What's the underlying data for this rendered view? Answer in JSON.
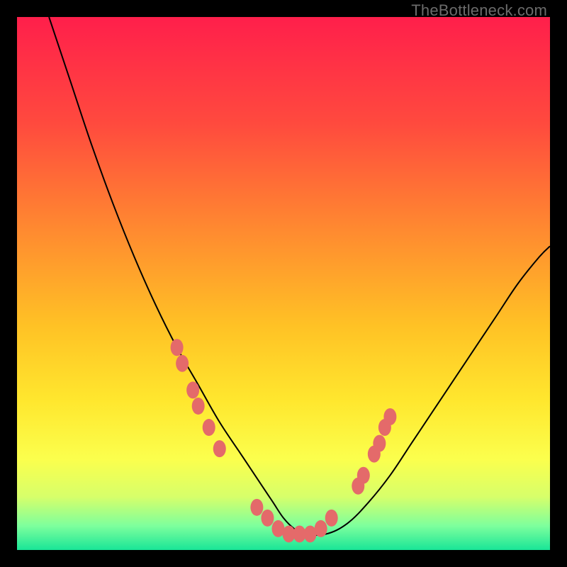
{
  "watermark": "TheBottleneck.com",
  "chart_data": {
    "type": "line",
    "title": "",
    "xlabel": "",
    "ylabel": "",
    "xlim": [
      0,
      100
    ],
    "ylim": [
      0,
      100
    ],
    "grid": false,
    "background_gradient": {
      "stops": [
        {
          "pos": 0.0,
          "color": "#ff1f4b"
        },
        {
          "pos": 0.2,
          "color": "#ff4a3e"
        },
        {
          "pos": 0.4,
          "color": "#ff8a30"
        },
        {
          "pos": 0.58,
          "color": "#ffc225"
        },
        {
          "pos": 0.72,
          "color": "#ffe72e"
        },
        {
          "pos": 0.83,
          "color": "#fbff4d"
        },
        {
          "pos": 0.9,
          "color": "#d7ff6a"
        },
        {
          "pos": 0.955,
          "color": "#7dff9d"
        },
        {
          "pos": 1.0,
          "color": "#19e597"
        }
      ]
    },
    "series": [
      {
        "name": "bottleneck-curve",
        "color": "#000000",
        "x": [
          6,
          10,
          14,
          18,
          22,
          26,
          30,
          34,
          38,
          42,
          46,
          48,
          50,
          52,
          54,
          58,
          62,
          66,
          70,
          74,
          78,
          82,
          86,
          90,
          94,
          98,
          100
        ],
        "y": [
          100,
          88,
          76,
          65,
          55,
          46,
          38,
          31,
          24,
          18,
          12,
          9,
          6,
          4,
          3,
          3,
          5,
          9,
          14,
          20,
          26,
          32,
          38,
          44,
          50,
          55,
          57
        ]
      }
    ],
    "markers": {
      "name": "highlight-dots",
      "color": "#e46a6a",
      "points": [
        {
          "x": 30,
          "y": 38
        },
        {
          "x": 31,
          "y": 35
        },
        {
          "x": 33,
          "y": 30
        },
        {
          "x": 34,
          "y": 27
        },
        {
          "x": 36,
          "y": 23
        },
        {
          "x": 38,
          "y": 19
        },
        {
          "x": 45,
          "y": 8
        },
        {
          "x": 47,
          "y": 6
        },
        {
          "x": 49,
          "y": 4
        },
        {
          "x": 51,
          "y": 3
        },
        {
          "x": 53,
          "y": 3
        },
        {
          "x": 55,
          "y": 3
        },
        {
          "x": 57,
          "y": 4
        },
        {
          "x": 59,
          "y": 6
        },
        {
          "x": 64,
          "y": 12
        },
        {
          "x": 65,
          "y": 14
        },
        {
          "x": 67,
          "y": 18
        },
        {
          "x": 68,
          "y": 20
        },
        {
          "x": 69,
          "y": 23
        },
        {
          "x": 70,
          "y": 25
        }
      ]
    }
  }
}
